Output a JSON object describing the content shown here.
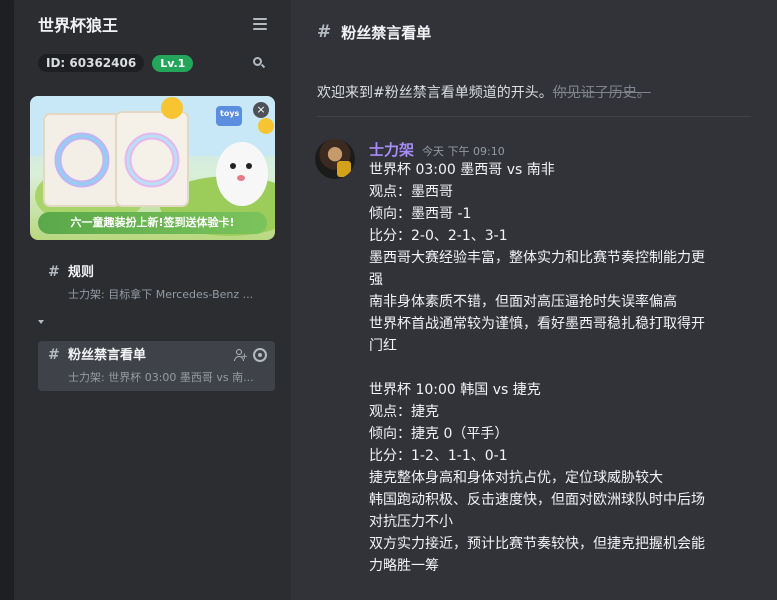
{
  "sidebar": {
    "guild_name": "世界杯狼王",
    "id_label": "ID: 60362406",
    "level": "Lv.1",
    "banner_caption": "六一童趣装扮上新!签到送体验卡!",
    "banner_sticker": "toys",
    "category": "",
    "channels": [
      {
        "name": "规则",
        "preview": "士力架: 目标拿下 Mercedes-Benz ..."
      },
      {
        "name": "粉丝禁言看单",
        "preview": "士力架: 世界杯 03:00 墨西哥 vs 南..."
      }
    ]
  },
  "main": {
    "channel_name": "粉丝禁言看单",
    "welcome": "欢迎来到#粉丝禁言看单频道的开头。",
    "welcome_sub": "你见证了历史。",
    "message": {
      "author": "士力架",
      "timestamp": "今天 下午 09:10",
      "lines1": [
        "世界杯 03:00 墨西哥 vs 南非",
        "观点：墨西哥",
        "倾向：墨西哥 -1",
        "比分：2-0、2-1、3-1",
        "墨西哥大赛经验丰富，整体实力和比赛节奏控制能力更",
        "强",
        "南非身体素质不错，但面对高压逼抢时失误率偏高",
        "世界杯首战通常较为谨慎，看好墨西哥稳扎稳打取得开",
        "门红"
      ],
      "lines2": [
        "世界杯 10:00 韩国 vs 捷克",
        "观点：捷克",
        "倾向：捷克 0（平手）",
        "比分：1-2、1-1、0-1",
        "捷克整体身高和身体对抗占优，定位球威胁较大",
        "韩国跑动积极、反击速度快，但面对欧洲球队时中后场",
        "对抗压力不小",
        "双方实力接近，预计比赛节奏较快，但捷克把握机会能",
        "力略胜一筹"
      ]
    }
  }
}
